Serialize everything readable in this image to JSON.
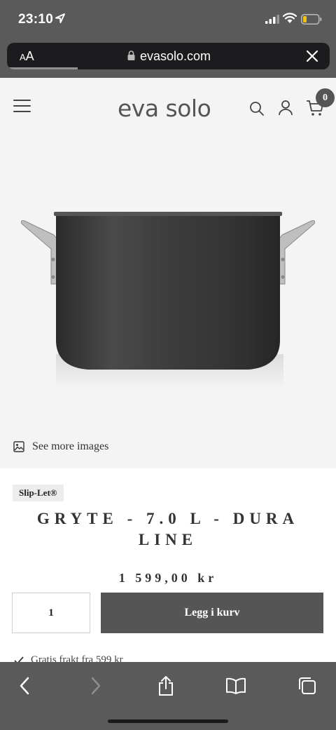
{
  "status_bar": {
    "time": "23:10",
    "icons": [
      "location-arrow-icon",
      "signal-icon",
      "wifi-icon",
      "battery-icon"
    ]
  },
  "browser": {
    "text_size_label": "AA",
    "url": "evasolo.com",
    "page_load_progress": 0.22
  },
  "header": {
    "logo": "eva solo",
    "cart_count": "0",
    "icons": [
      "menu-icon",
      "search-icon",
      "account-icon",
      "cart-icon"
    ]
  },
  "gallery": {
    "see_more_label": "See more images"
  },
  "product": {
    "brand": "Slip-Let®",
    "title": "GRYTE - 7.0 L - DURA LINE",
    "price": "1 599,00 kr",
    "quantity": "1",
    "add_to_cart_label": "Legg i kurv",
    "shipping_note": "Gratis frakt fra 599 kr"
  },
  "toolbar": {
    "icons": [
      "back-icon",
      "forward-icon",
      "share-icon",
      "bookmarks-icon",
      "tabs-icon"
    ]
  },
  "colors": {
    "chrome": "#5a5a5a",
    "page_bg": "#f4f4f4",
    "button": "#555555"
  }
}
